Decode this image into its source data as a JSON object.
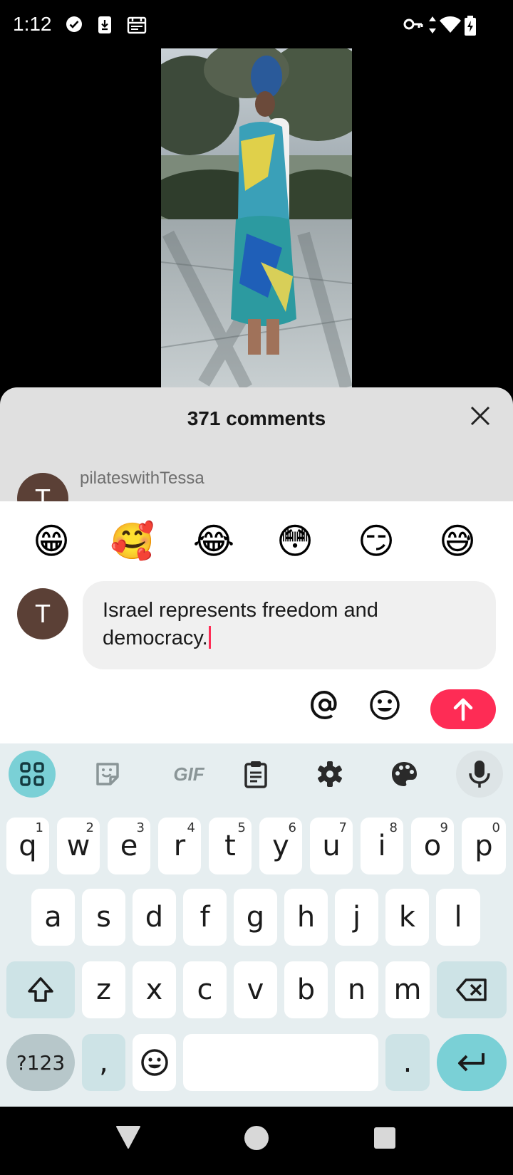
{
  "status_bar": {
    "time": "1:12",
    "icons": [
      "check-circle-icon",
      "download-icon",
      "calendar-icon",
      "key-icon",
      "data-arrows-icon",
      "wifi-icon",
      "battery-charging-icon"
    ]
  },
  "comments_sheet": {
    "title": "371 comments",
    "first_comment": {
      "avatar_letter": "T",
      "username": "pilateswithTessa",
      "text_cut": "..."
    }
  },
  "emoji_bar": [
    "😁",
    "🥰",
    "😂",
    "😳",
    "😏",
    "😅"
  ],
  "composer": {
    "avatar_letter": "T",
    "input_value": "Israel represents freedom and democracy."
  },
  "keyboard": {
    "toolbar": [
      "apps-grid-icon",
      "sticker-icon",
      "gif-icon",
      "clipboard-icon",
      "settings-gear-icon",
      "palette-icon",
      "microphone-icon"
    ],
    "gif_label": "GIF",
    "row1": [
      {
        "key": "q",
        "hint": "1"
      },
      {
        "key": "w",
        "hint": "2"
      },
      {
        "key": "e",
        "hint": "3"
      },
      {
        "key": "r",
        "hint": "4"
      },
      {
        "key": "t",
        "hint": "5"
      },
      {
        "key": "y",
        "hint": "6"
      },
      {
        "key": "u",
        "hint": "7"
      },
      {
        "key": "i",
        "hint": "8"
      },
      {
        "key": "o",
        "hint": "9"
      },
      {
        "key": "p",
        "hint": "0"
      }
    ],
    "row2": [
      "a",
      "s",
      "d",
      "f",
      "g",
      "h",
      "j",
      "k",
      "l"
    ],
    "row3": [
      "z",
      "x",
      "c",
      "v",
      "b",
      "n",
      "m"
    ],
    "symbols_label": "?123",
    "comma": ",",
    "period": "."
  },
  "colors": {
    "accent": "#fe2c55",
    "avatar": "#5b4036",
    "keyboard_bg": "#e6eef0",
    "key_special": "#cde3e6",
    "enter_key": "#7ad0d6"
  }
}
